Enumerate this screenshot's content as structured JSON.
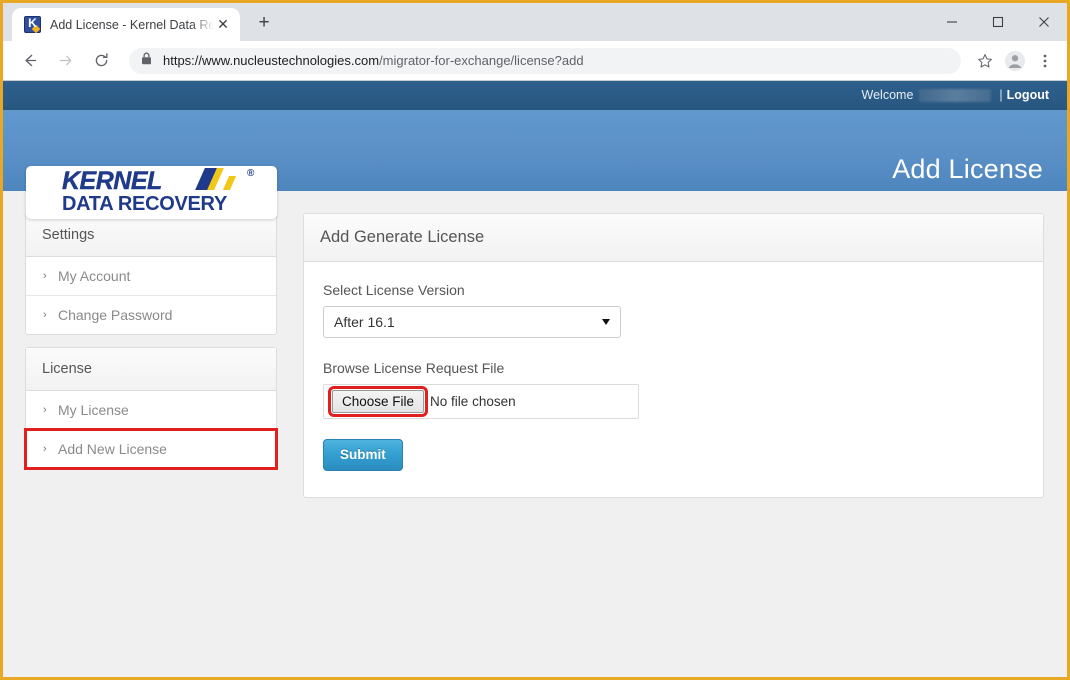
{
  "browser": {
    "tab": {
      "title": "Add License - Kernel Data Recove",
      "favicon_name": "kernel-favicon",
      "close_label": "✕"
    },
    "new_tab_label": "+",
    "window_controls": {
      "minimize": "minimize-icon",
      "maximize": "maximize-icon",
      "close": "close-icon"
    },
    "toolbar": {
      "back": "back-arrow-icon",
      "forward": "forward-arrow-icon",
      "reload": "reload-icon",
      "lock": "lock-icon",
      "url_scheme": "https://www.nucleustechnologies.com",
      "url_path": "/migrator-for-exchange/license?add",
      "bookmark": "star-icon",
      "profile": "profile-avatar-icon",
      "menu": "three-dot-menu-icon"
    }
  },
  "site": {
    "topbar": {
      "welcome_label": "Welcome",
      "separator": "|",
      "logout_label": "Logout"
    },
    "logo": {
      "primary": "KERNEL",
      "registered": "®",
      "secondary": "DATA RECOVERY"
    },
    "banner": {
      "title": "Add License"
    },
    "sidebar": {
      "panels": [
        {
          "heading": "Settings",
          "items": [
            {
              "label": "My Account",
              "highlighted": false
            },
            {
              "label": "Change Password",
              "highlighted": false
            }
          ]
        },
        {
          "heading": "License",
          "items": [
            {
              "label": "My License",
              "highlighted": false
            },
            {
              "label": "Add New License",
              "highlighted": true
            }
          ]
        }
      ],
      "chevron": "›"
    },
    "main": {
      "card_title": "Add Generate License",
      "version_label": "Select License Version",
      "version_value": "After 16.1",
      "browse_label": "Browse License Request File",
      "choose_file_label": "Choose File",
      "no_file_text": "No file chosen",
      "submit_label": "Submit"
    },
    "colors": {
      "topbar": "#2b5d8b",
      "banner": "#5a90c6",
      "highlight": "#e01f1f",
      "submit": "#35a0d2",
      "logo_blue": "#1f3a8a",
      "logo_yellow": "#f3c718"
    }
  }
}
